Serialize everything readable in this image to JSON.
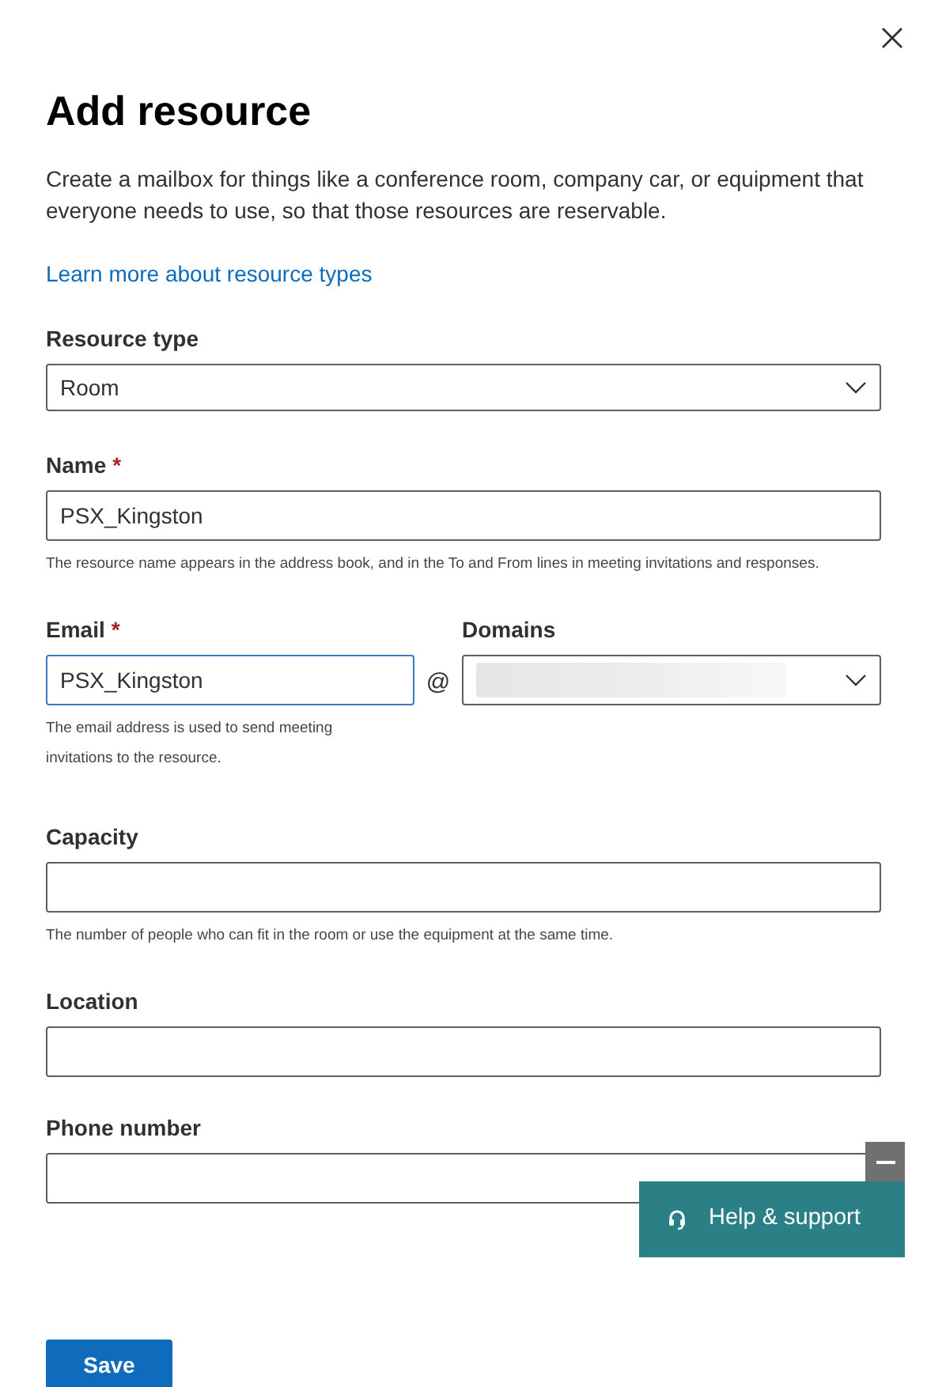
{
  "panel": {
    "title": "Add resource",
    "description": "Create a mailbox for things like a conference room, company car, or equipment that everyone needs to use, so that those resources are reservable.",
    "learn_more_link": "Learn more about resource types"
  },
  "fields": [
    {
      "kind": "dropdown",
      "label": "Resource type",
      "value": "Room"
    },
    {
      "kind": "text",
      "label": "Name",
      "required_mark": "*",
      "value": "PSX_Kingston",
      "help": "The resource name appears in the address book, and in the To and From lines in meeting invitations and responses."
    },
    {
      "kind": "email",
      "label": "Email",
      "required_mark": "*",
      "value": "PSX_Kingston",
      "focused": true,
      "help": "The email address is used to send meeting invitations to the resource.",
      "at_sign": "@",
      "domain_label": "Domains"
    },
    {
      "kind": "text",
      "label": "Capacity",
      "help": "The number of people who can fit in the room or use the equipment at the same time."
    },
    {
      "kind": "text",
      "label": "Location"
    },
    {
      "kind": "text",
      "label": "Phone number"
    }
  ],
  "help_widget": {
    "label": "Help & support"
  },
  "save_button": "Save"
}
